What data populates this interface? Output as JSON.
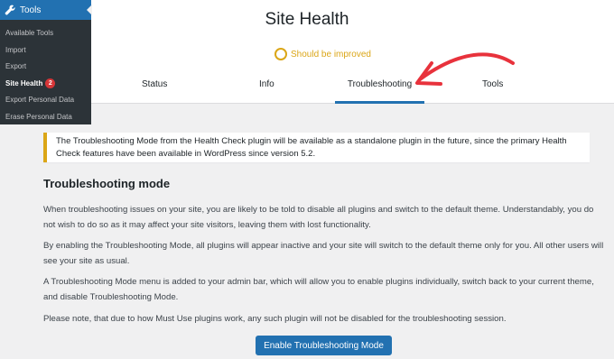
{
  "sidebar": {
    "menu_label": "Tools",
    "icon": "wrench-icon",
    "items": [
      {
        "label": "Available Tools"
      },
      {
        "label": "Import"
      },
      {
        "label": "Export"
      },
      {
        "label": "Site Health",
        "badge": "2"
      },
      {
        "label": "Export Personal Data"
      },
      {
        "label": "Erase Personal Data"
      }
    ]
  },
  "header": {
    "title": "Site Health",
    "status_label": "Should be improved",
    "status_color": "#dba617"
  },
  "tabs": [
    {
      "label": "Status"
    },
    {
      "label": "Info"
    },
    {
      "label": "Troubleshooting",
      "active": true
    },
    {
      "label": "Tools"
    }
  ],
  "notice": {
    "text": "The Troubleshooting Mode from the Health Check plugin will be available as a standalone plugin in the future, since the primary Health Check features have been available in WordPress since version 5.2."
  },
  "main": {
    "section_title": "Troubleshooting mode",
    "paragraphs": [
      "When troubleshooting issues on your site, you are likely to be told to disable all plugins and switch to the default theme. Understandably, you do not wish to do so as it may affect your site visitors, leaving them with lost functionality.",
      "By enabling the Troubleshooting Mode, all plugins will appear inactive and your site will switch to the default theme only for you. All other users will see your site as usual.",
      "A Troubleshooting Mode menu is added to your admin bar, which will allow you to enable plugins individually, switch back to your current theme, and disable Troubleshooting Mode.",
      "Please note, that due to how Must Use plugins work, any such plugin will not be disabled for the troubleshooting session."
    ],
    "button_label": "Enable Troubleshooting Mode"
  },
  "colors": {
    "accent": "#2271b1",
    "sidebar_bg": "#2c3338",
    "warning": "#dba617",
    "badge": "#d63638",
    "annotation_arrow": "#e8323c"
  }
}
